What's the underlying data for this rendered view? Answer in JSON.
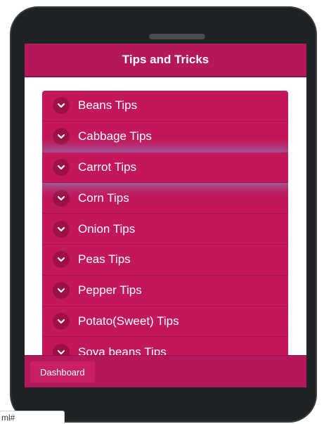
{
  "header": {
    "title": "Tips and Tricks"
  },
  "tips": [
    {
      "label": "Beans Tips"
    },
    {
      "label": "Cabbage Tips"
    },
    {
      "label": "Carrot Tips"
    },
    {
      "label": "Corn Tips"
    },
    {
      "label": "Onion Tips"
    },
    {
      "label": "Peas Tips"
    },
    {
      "label": "Pepper Tips"
    },
    {
      "label": "Potato(Sweet) Tips"
    },
    {
      "label": "Soya beans Tips"
    }
  ],
  "footer": {
    "dashboard_label": "Dashboard"
  },
  "status_bar": {
    "url_text": "ml#"
  },
  "icons": {
    "expand": "chevron-down-icon"
  },
  "colors": {
    "primary": "#c2185b",
    "header": "#b5175b",
    "phone_frame": "#1f2224"
  }
}
